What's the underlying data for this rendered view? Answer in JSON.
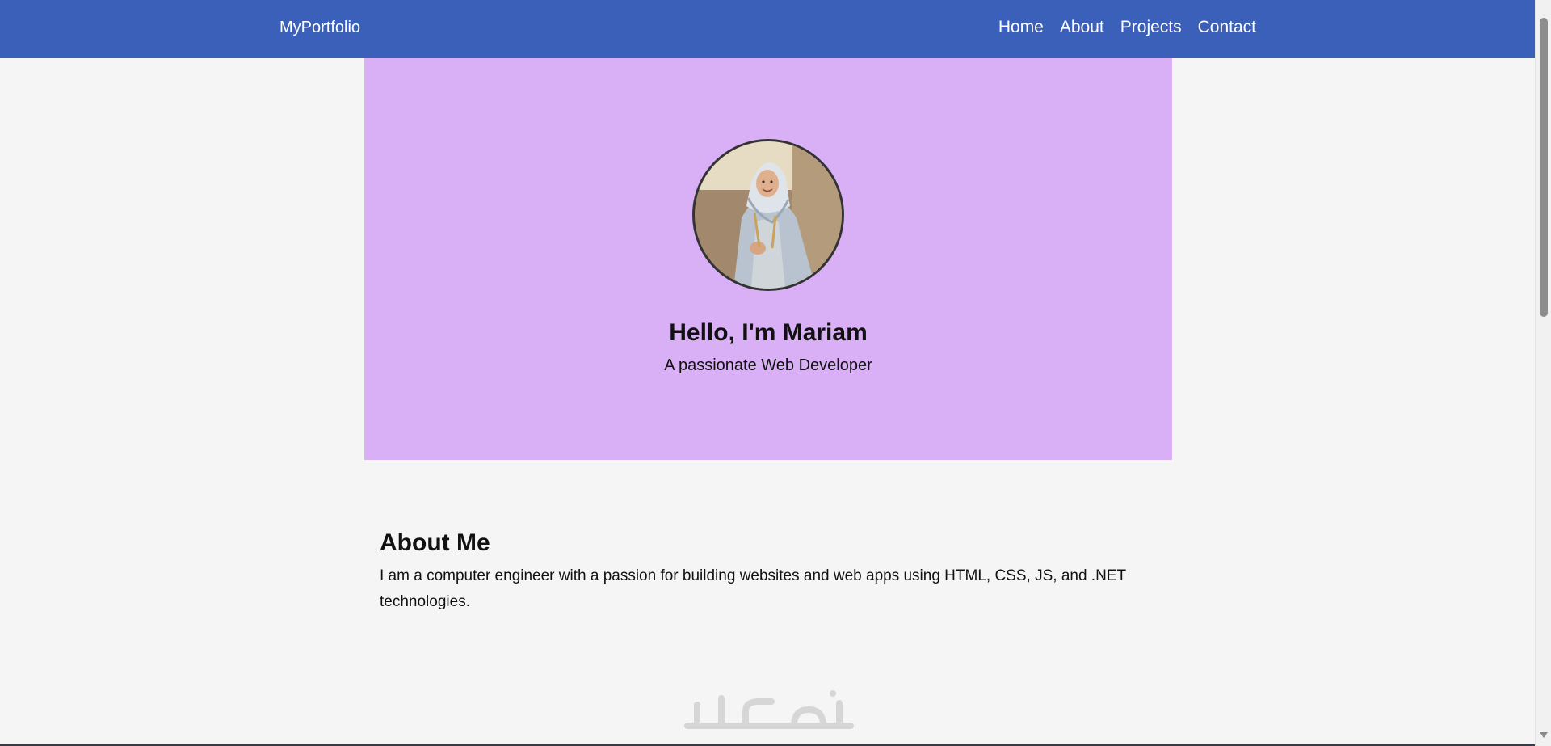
{
  "nav": {
    "brand": "MyPortfolio",
    "links": [
      "Home",
      "About",
      "Projects",
      "Contact"
    ]
  },
  "hero": {
    "title": "Hello, I'm Mariam",
    "subtitle": "A passionate Web Developer"
  },
  "about": {
    "heading": "About Me",
    "body": "I am a computer engineer with a passion for building websites and web apps using HTML, CSS, JS, and .NET technologies."
  },
  "watermark": "خمسات",
  "colors": {
    "navbar": "#3b60b9",
    "hero": "#d9b0f6",
    "page": "#f5f5f5"
  }
}
